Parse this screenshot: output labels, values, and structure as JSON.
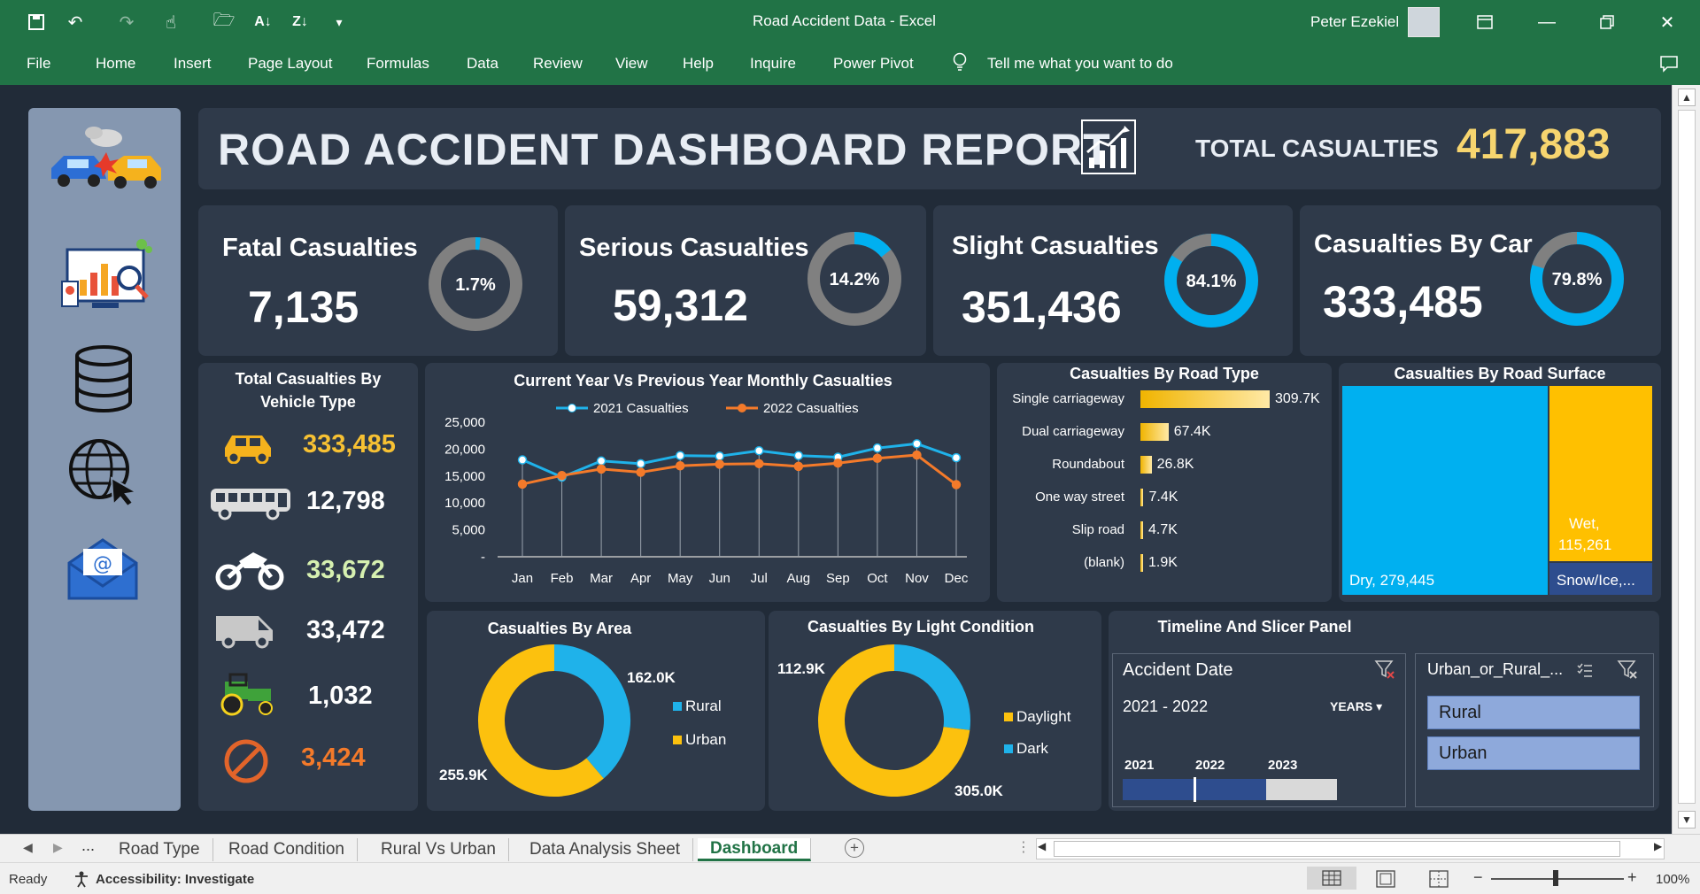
{
  "window": {
    "title": "Road Accident Data  -  Excel",
    "user": "Peter Ezekiel",
    "menu": [
      "File",
      "Home",
      "Insert",
      "Page Layout",
      "Formulas",
      "Data",
      "Review",
      "View",
      "Help",
      "Inquire",
      "Power Pivot"
    ],
    "tell_me": "Tell me what you want to do"
  },
  "dashboard": {
    "title": "ROAD ACCIDENT DASHBOARD REPORT",
    "total_label": "TOTAL CASUALTIES",
    "total_value": "417,883",
    "kpis": [
      {
        "label": "Fatal Casualties",
        "value": "7,135",
        "pct_label": "1.7%",
        "pct": 1.7
      },
      {
        "label": "Serious Casualties",
        "value": "59,312",
        "pct_label": "14.2%",
        "pct": 14.2
      },
      {
        "label": "Slight Casualties",
        "value": "351,436",
        "pct_label": "84.1%",
        "pct": 84.1
      },
      {
        "label": "Casualties By Car",
        "value": "333,485",
        "pct_label": "79.8%",
        "pct": 79.8
      }
    ],
    "vehicle": {
      "title_line1": "Total Casualties By",
      "title_line2": "Vehicle Type",
      "items": [
        {
          "icon": "car-icon",
          "value": "333,485",
          "color": "#f7c133"
        },
        {
          "icon": "bus-icon",
          "value": "12,798",
          "color": "#ffffff"
        },
        {
          "icon": "motorcycle-icon",
          "value": "33,672",
          "color": "#d6f0b0"
        },
        {
          "icon": "van-icon",
          "value": "33,472",
          "color": "#ffffff"
        },
        {
          "icon": "tractor-icon",
          "value": "1,032",
          "color": "#ffffff"
        },
        {
          "icon": "prohibited-icon",
          "value": "3,424",
          "color": "#f47a2a"
        }
      ]
    },
    "monthly": {
      "title": "Current Year Vs Previous Year Monthly Casualties"
    },
    "road_type": {
      "title": "Casualties By Road Type"
    },
    "surface": {
      "title": "Casualties By Road Surface",
      "dry": "Dry,  279,445",
      "wet_l1": "Wet,",
      "wet_l2": "115,261",
      "snow": "Snow/Ice,..."
    },
    "area": {
      "title": "Casualties By Area",
      "rural_value": "162.0K",
      "urban_value": "255.9K",
      "legend": [
        "Rural",
        "Urban"
      ]
    },
    "light": {
      "title": "Casualties By Light Condition",
      "dark_value": "112.9K",
      "daylight_value": "305.0K",
      "legend": [
        "Daylight",
        "Dark"
      ]
    },
    "slicers": {
      "title": "Timeline And Slicer Panel",
      "timeline_title": "Accident Date",
      "timeline_range": "2021 - 2022",
      "timeline_unit": "YEARS",
      "years": [
        "2021",
        "2022",
        "2023"
      ],
      "slicer_title": "Urban_or_Rural_...",
      "options": [
        "Rural",
        "Urban"
      ]
    }
  },
  "chart_data": [
    {
      "type": "line",
      "title": "Current Year Vs Previous Year Monthly Casualties",
      "categories": [
        "Jan",
        "Feb",
        "Mar",
        "Apr",
        "May",
        "Jun",
        "Jul",
        "Aug",
        "Sep",
        "Oct",
        "Nov",
        "Dec"
      ],
      "series": [
        {
          "name": "2021 Casualties",
          "color": "#1fb2ea",
          "values": [
            18000,
            14800,
            17800,
            17300,
            18800,
            18700,
            19700,
            18800,
            18500,
            20200,
            21000,
            18400
          ]
        },
        {
          "name": "2022 Casualties",
          "color": "#f47a2a",
          "values": [
            13500,
            15100,
            16300,
            15700,
            16900,
            17200,
            17300,
            16800,
            17400,
            18300,
            18900,
            13400
          ]
        }
      ],
      "yticks": [
        "25,000",
        "20,000",
        "15,000",
        "10,000",
        "5,000",
        "-"
      ],
      "ylim": [
        0,
        25000
      ]
    },
    {
      "type": "bar",
      "title": "Casualties By Road Type",
      "categories": [
        "Single carriageway",
        "Dual carriageway",
        "Roundabout",
        "One way street",
        "Slip road",
        "(blank)"
      ],
      "values": [
        309700,
        67400,
        26800,
        7400,
        4700,
        1900
      ],
      "labels": [
        "309.7K",
        "67.4K",
        "26.8K",
        "7.4K",
        "4.7K",
        "1.9K"
      ]
    },
    {
      "type": "heatmap",
      "title": "Casualties By Road Surface",
      "categories": [
        "Dry",
        "Wet",
        "Snow/Ice"
      ],
      "values": [
        279445,
        115261,
        23177
      ]
    },
    {
      "type": "pie",
      "title": "Casualties By Area",
      "categories": [
        "Rural",
        "Urban"
      ],
      "values": [
        162000,
        255900
      ],
      "colors": [
        "#1fb2ea",
        "#fcc10e"
      ]
    },
    {
      "type": "pie",
      "title": "Casualties By Light Condition",
      "categories": [
        "Dark",
        "Daylight"
      ],
      "values": [
        112900,
        305000
      ],
      "colors": [
        "#1fb2ea",
        "#fcc10e"
      ]
    }
  ],
  "tabs": [
    "Road Type",
    "Road Condition",
    "Rural Vs Urban",
    "Data Analysis Sheet",
    "Dashboard"
  ],
  "status": {
    "ready": "Ready",
    "accessibility": "Accessibility: Investigate",
    "zoom": "100%"
  }
}
